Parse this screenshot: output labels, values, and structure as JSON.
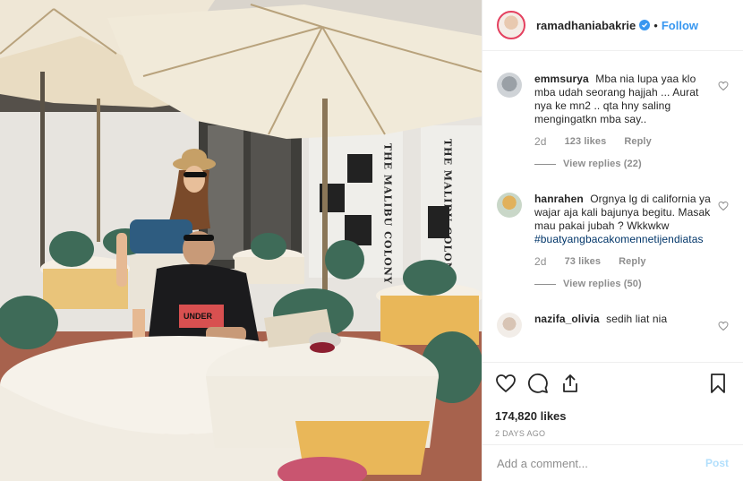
{
  "header": {
    "username": "ramadhaniabakrie",
    "follow_label": "Follow",
    "separator": "•"
  },
  "photo": {
    "sign_text_1": "THE MALIBU COLONY CO",
    "sign_text_2": "THE MALIBU COLONY CO",
    "shirt_text": "UNDER"
  },
  "comments": [
    {
      "username": "emmsurya",
      "text": "Mba nia lupa yaa klo mba udah seorang hajjah ... Aurat nya ke mn2 .. qta hny saling mengingatkn mba say..",
      "time": "2d",
      "likes": "123 likes",
      "reply_label": "Reply",
      "view_replies": "View replies (22)"
    },
    {
      "username": "hanrahen",
      "text": "Orgnya lg di california ya wajar aja kali bajunya begitu. Masak mau pakai jubah ? Wkkwkw",
      "hashtag": "#buatyangbacakomennetijendiatas",
      "time": "2d",
      "likes": "73 likes",
      "reply_label": "Reply",
      "view_replies": "View replies (50)"
    },
    {
      "username": "nazifa_olivia",
      "text": "sedih liat nia"
    }
  ],
  "actions": {
    "likes": "174,820 likes",
    "timestamp": "2 DAYS AGO"
  },
  "add_comment": {
    "placeholder": "Add a comment...",
    "post_label": "Post"
  },
  "colors": {
    "accent": "#3897f0",
    "text": "#262626",
    "muted": "#8e8e8e",
    "post_disabled": "#b2dffc",
    "hashtag": "#003569"
  }
}
